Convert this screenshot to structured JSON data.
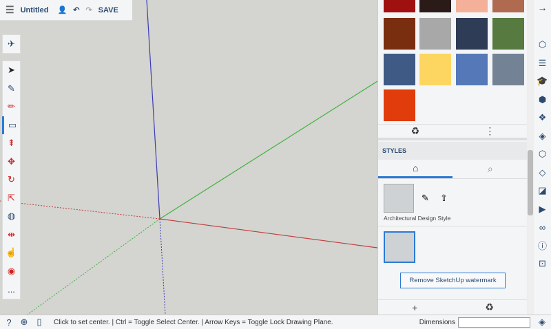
{
  "topbar": {
    "title": "Untitled",
    "save": "SAVE"
  },
  "colors": [
    "#a01010",
    "#2a1a18",
    "#f5b09a",
    "#b06a50",
    "#7a2e10",
    "#a8a8a8",
    "#2e3c55",
    "#567a40",
    "#3e5a85",
    "#fcd660",
    "#5478b8",
    "#748296",
    "#e03c0c"
  ],
  "styles": {
    "heading": "STYLES",
    "style_name": "Architectural Design Style",
    "watermark_button": "Remove SketchUp watermark"
  },
  "status": {
    "message": "Click to set center. | Ctrl = Toggle Select Center. | Arrow Keys = Toggle Lock Drawing Plane.",
    "dimensions_label": "Dimensions",
    "dimensions_value": ""
  },
  "tools": [
    "select",
    "eraser",
    "pencil",
    "rectangle",
    "push-pull",
    "move",
    "rotate",
    "scale",
    "paint-bucket",
    "section-plane",
    "orbit",
    "walk"
  ],
  "more": "..."
}
